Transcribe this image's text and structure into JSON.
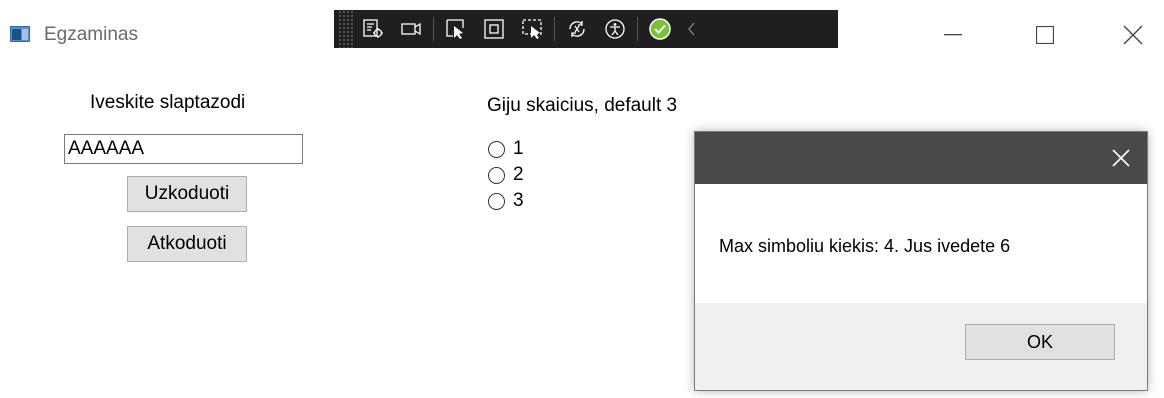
{
  "window": {
    "title": "Egzaminas",
    "controls": [
      "minimize",
      "maximize",
      "close"
    ]
  },
  "debug_toolbar": {
    "icons": [
      "live-visual-tree-icon",
      "video-camera-icon",
      "select-element-icon",
      "display-layout-adorners-icon",
      "track-focus-icon",
      "hot-reload-icon",
      "accessibility-icon",
      "check-status-icon",
      "collapse-chevron-icon"
    ],
    "status_color": "#7cc035"
  },
  "password": {
    "label": "Iveskite slaptazodi",
    "value": "AAAAAA",
    "encode_label": "Uzkoduoti",
    "decode_label": "Atkoduoti"
  },
  "threads": {
    "title": "Giju skaicius, default 3",
    "options": [
      "1",
      "2",
      "3"
    ]
  },
  "message_box": {
    "message": "Max simboliu kiekis: 4. Jus ivedete 6",
    "ok_label": "OK",
    "titlebar_color": "#494949"
  }
}
